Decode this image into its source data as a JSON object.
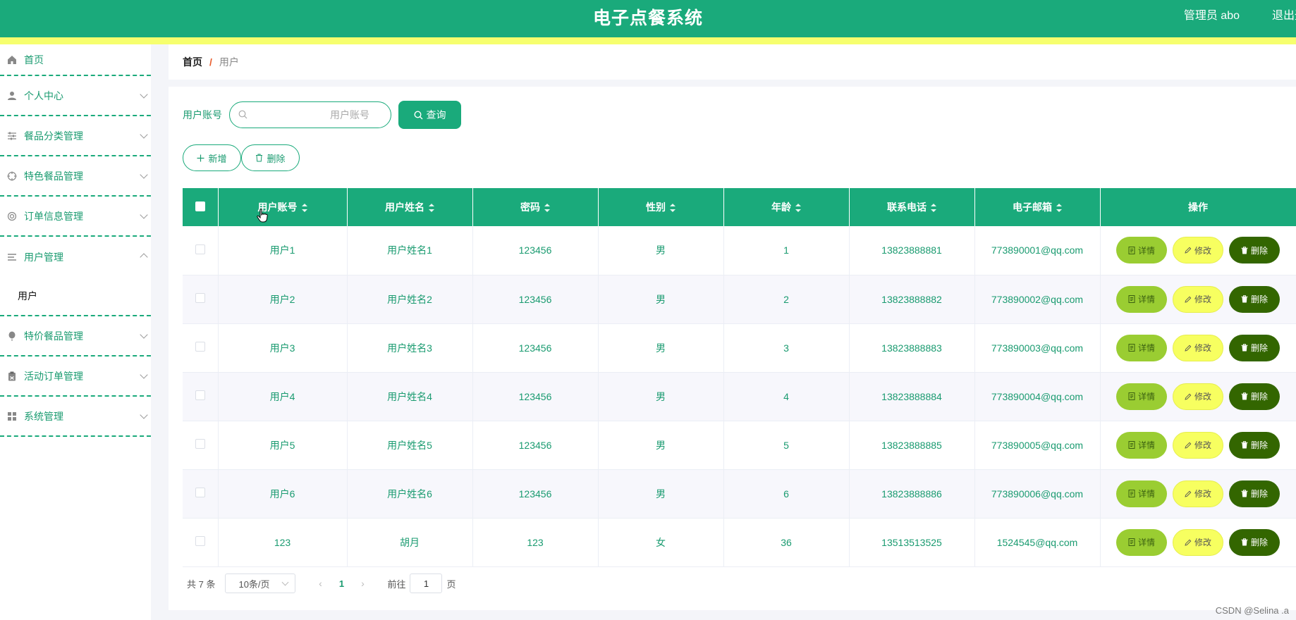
{
  "header": {
    "title": "电子点餐系统",
    "user_label": "管理员 abo",
    "logout_label": "退出登"
  },
  "sidebar": {
    "items": [
      {
        "label": "首页",
        "icon": "home-icon"
      },
      {
        "label": "个人中心",
        "icon": "user-icon"
      },
      {
        "label": "餐品分类管理",
        "icon": "sliders-icon"
      },
      {
        "label": "特色餐品管理",
        "icon": "crosshair-icon"
      },
      {
        "label": "订单信息管理",
        "icon": "lifebuoy-icon"
      },
      {
        "label": "用户管理",
        "icon": "list-icon",
        "expanded": true,
        "sub": "用户"
      },
      {
        "label": "特价餐品管理",
        "icon": "balloon-icon"
      },
      {
        "label": "活动订单管理",
        "icon": "clipboard-icon"
      },
      {
        "label": "系统管理",
        "icon": "grid-icon"
      }
    ]
  },
  "breadcrumb": {
    "home": "首页",
    "sep": "/",
    "current": "用户"
  },
  "search": {
    "label": "用户账号",
    "placeholder": "用户账号",
    "button": "查询"
  },
  "actions": {
    "add": "新增",
    "delete": "删除"
  },
  "table": {
    "headers": [
      "用户账号",
      "用户姓名",
      "密码",
      "性别",
      "年龄",
      "联系电话",
      "电子邮箱",
      "操作"
    ],
    "rows": [
      {
        "account": "用户1",
        "name": "用户姓名1",
        "password": "123456",
        "gender": "男",
        "age": "1",
        "phone": "13823888881",
        "email": "773890001@qq.com"
      },
      {
        "account": "用户2",
        "name": "用户姓名2",
        "password": "123456",
        "gender": "男",
        "age": "2",
        "phone": "13823888882",
        "email": "773890002@qq.com"
      },
      {
        "account": "用户3",
        "name": "用户姓名3",
        "password": "123456",
        "gender": "男",
        "age": "3",
        "phone": "13823888883",
        "email": "773890003@qq.com"
      },
      {
        "account": "用户4",
        "name": "用户姓名4",
        "password": "123456",
        "gender": "男",
        "age": "4",
        "phone": "13823888884",
        "email": "773890004@qq.com"
      },
      {
        "account": "用户5",
        "name": "用户姓名5",
        "password": "123456",
        "gender": "男",
        "age": "5",
        "phone": "13823888885",
        "email": "773890005@qq.com"
      },
      {
        "account": "用户6",
        "name": "用户姓名6",
        "password": "123456",
        "gender": "男",
        "age": "6",
        "phone": "13823888886",
        "email": "773890006@qq.com"
      },
      {
        "account": "123",
        "name": "胡月",
        "password": "123",
        "gender": "女",
        "age": "36",
        "phone": "13513513525",
        "email": "1524545@qq.com"
      }
    ],
    "op_labels": {
      "detail": "详情",
      "edit": "修改",
      "delete": "删除"
    }
  },
  "pagination": {
    "total": "共 7 条",
    "page_size": "10条/页",
    "current_page": "1",
    "goto_prefix": "前往",
    "goto_value": "1",
    "goto_suffix": "页"
  },
  "watermark": "CSDN @Selina .a",
  "colors": {
    "primary": "#1aaa7b",
    "stripe": "#f6ff6e",
    "detail_btn": "#9acd32",
    "edit_btn": "#f7ff60",
    "delete_btn": "#336600"
  }
}
